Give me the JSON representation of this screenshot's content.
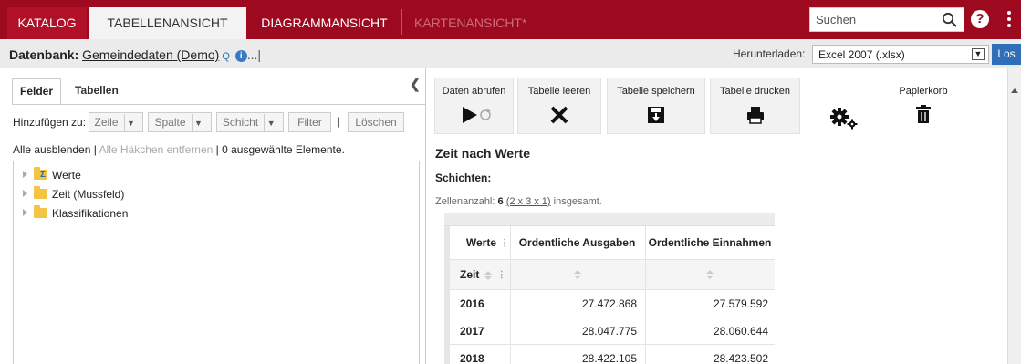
{
  "nav": {
    "tabs": [
      "KATALOG",
      "TABELLENANSICHT",
      "DIAGRAMMANSICHT",
      "KARTENANSICHT*"
    ],
    "search_placeholder": "Suchen",
    "help_label": "?"
  },
  "dbbar": {
    "prefix": "Datenbank:",
    "name": "Gemeindedaten (Demo)",
    "q": "Q",
    "info": "i",
    "dots": "...|",
    "download_label": "Herunterladen:",
    "download_format": "Excel 2007 (.xlsx)",
    "go_label": "Los"
  },
  "left": {
    "tabs": [
      "Felder",
      "Tabellen"
    ],
    "add_label": "Hinzufügen zu:",
    "buttons": {
      "zeile": "Zeile",
      "spalte": "Spalte",
      "schicht": "Schicht",
      "filter": "Filter",
      "loeschen": "Löschen"
    },
    "pipe": "|",
    "info": {
      "hide_all": "Alle ausblenden",
      "sep1": "|",
      "remove_checks": "Alle Häkchen entfernen",
      "sep2": "|",
      "selected": "0 ausgewählte Elemente."
    },
    "tree": [
      "Werte",
      "Zeit (Mussfeld)",
      "Klassifikationen"
    ]
  },
  "toolbar": {
    "fetch": "Daten abrufen",
    "clear": "Tabelle leeren",
    "save": "Tabelle speichern",
    "print": "Tabelle drucken",
    "trash": "Papierkorb"
  },
  "content": {
    "title": "Zeit nach Werte",
    "layers": "Schichten:",
    "cells_prefix": "Zellenanzahl:",
    "cells_count": "6",
    "cells_formula": "(2 x 3 x 1)",
    "cells_suffix": "insgesamt."
  },
  "pivot": {
    "col_header": "Werte",
    "row_header": "Zeit",
    "columns": [
      "Ordentliche Ausgaben",
      "Ordentliche Einnahmen"
    ],
    "rows": [
      {
        "year": "2016",
        "ausgaben": "27.472.868",
        "einnahmen": "27.579.592"
      },
      {
        "year": "2017",
        "ausgaben": "28.047.775",
        "einnahmen": "28.060.644"
      },
      {
        "year": "2018",
        "ausgaben": "28.422.105",
        "einnahmen": "28.423.502"
      }
    ]
  }
}
